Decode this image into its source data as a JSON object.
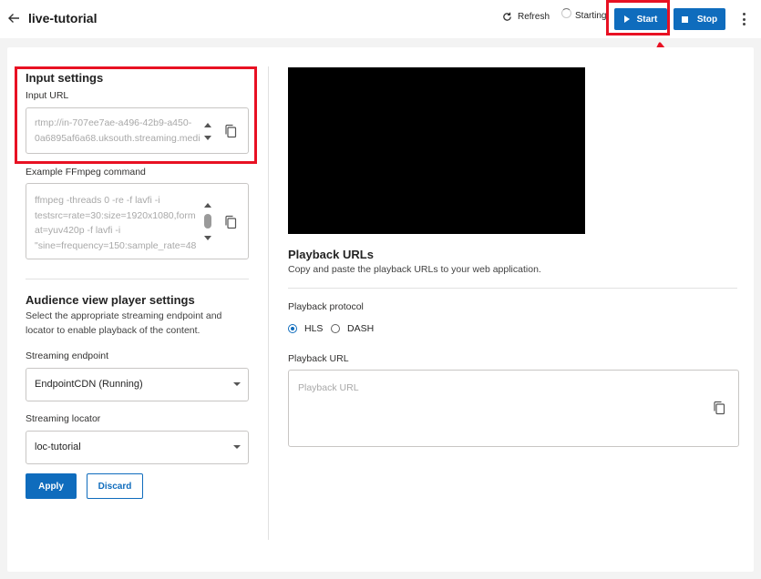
{
  "header": {
    "title": "live-tutorial",
    "refresh_label": "Refresh",
    "status_label": "Starting",
    "start_label": "Start",
    "stop_label": "Stop"
  },
  "input_settings": {
    "heading": "Input settings",
    "input_url_label": "Input URL",
    "input_url_value": "rtmp://in-707ee7ae-a496-42b9-a450-\n0a6895af6a68.uksouth.streaming.medi",
    "ffmpeg_label": "Example FFmpeg command",
    "ffmpeg_value": "ffmpeg -threads 0 -re -f lavfi -i\ntestsrc=rate=30:size=1920x1080,form\nat=yuv420p -f lavfi -i\n\"sine=frequency=150:sample_rate=48"
  },
  "audience": {
    "heading": "Audience view player settings",
    "description_line1": "Select the appropriate streaming endpoint and",
    "description_line2": "locator to enable playback of the content.",
    "endpoint_label": "Streaming endpoint",
    "endpoint_value": "EndpointCDN (Running)",
    "locator_label": "Streaming locator",
    "locator_value": "loc-tutorial",
    "apply_label": "Apply",
    "discard_label": "Discard"
  },
  "playback": {
    "heading": "Playback URLs",
    "description": "Copy and paste the playback URLs to your web application.",
    "protocol_label": "Playback protocol",
    "protocols": [
      {
        "label": "HLS",
        "selected": true
      },
      {
        "label": "DASH",
        "selected": false
      }
    ],
    "url_label": "Playback URL",
    "url_placeholder": "Playback URL"
  },
  "colors": {
    "accent": "#0f6cbd",
    "annotation": "#e81123"
  },
  "icons": [
    "back-arrow-icon",
    "refresh-icon",
    "spinner-icon",
    "play-icon",
    "stop-icon",
    "more-vertical-icon",
    "copy-icon"
  ]
}
